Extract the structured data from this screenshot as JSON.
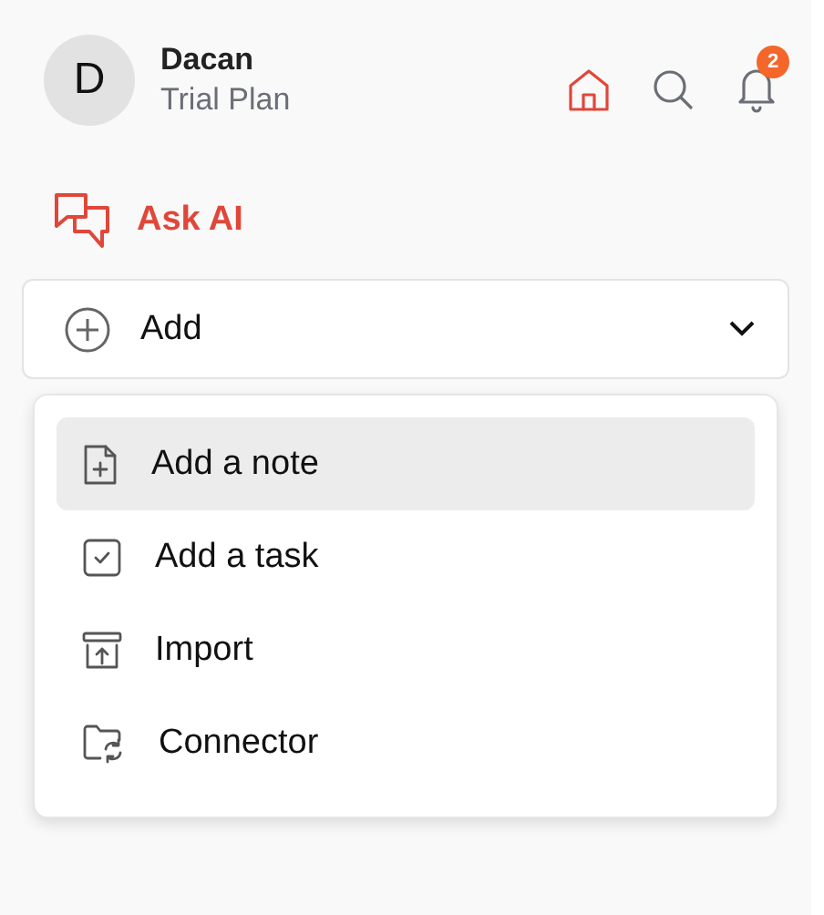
{
  "user": {
    "initial": "D",
    "name": "Dacan",
    "plan": "Trial Plan"
  },
  "nav": [
    {
      "kind": "home",
      "selected": true
    },
    {
      "kind": "search",
      "selected": false
    },
    {
      "kind": "bell",
      "selected": false,
      "badge": "2"
    }
  ],
  "ask_ai": {
    "label": "Ask AI"
  },
  "add_dropdown": {
    "label": "Add",
    "expanded": true
  },
  "menu": [
    {
      "kind": "note",
      "label": "Add a note",
      "selected": true
    },
    {
      "kind": "task",
      "label": "Add a task",
      "selected": false
    },
    {
      "kind": "import",
      "label": "Import",
      "selected": false
    },
    {
      "kind": "connector",
      "label": "Connector",
      "selected": false
    }
  ]
}
